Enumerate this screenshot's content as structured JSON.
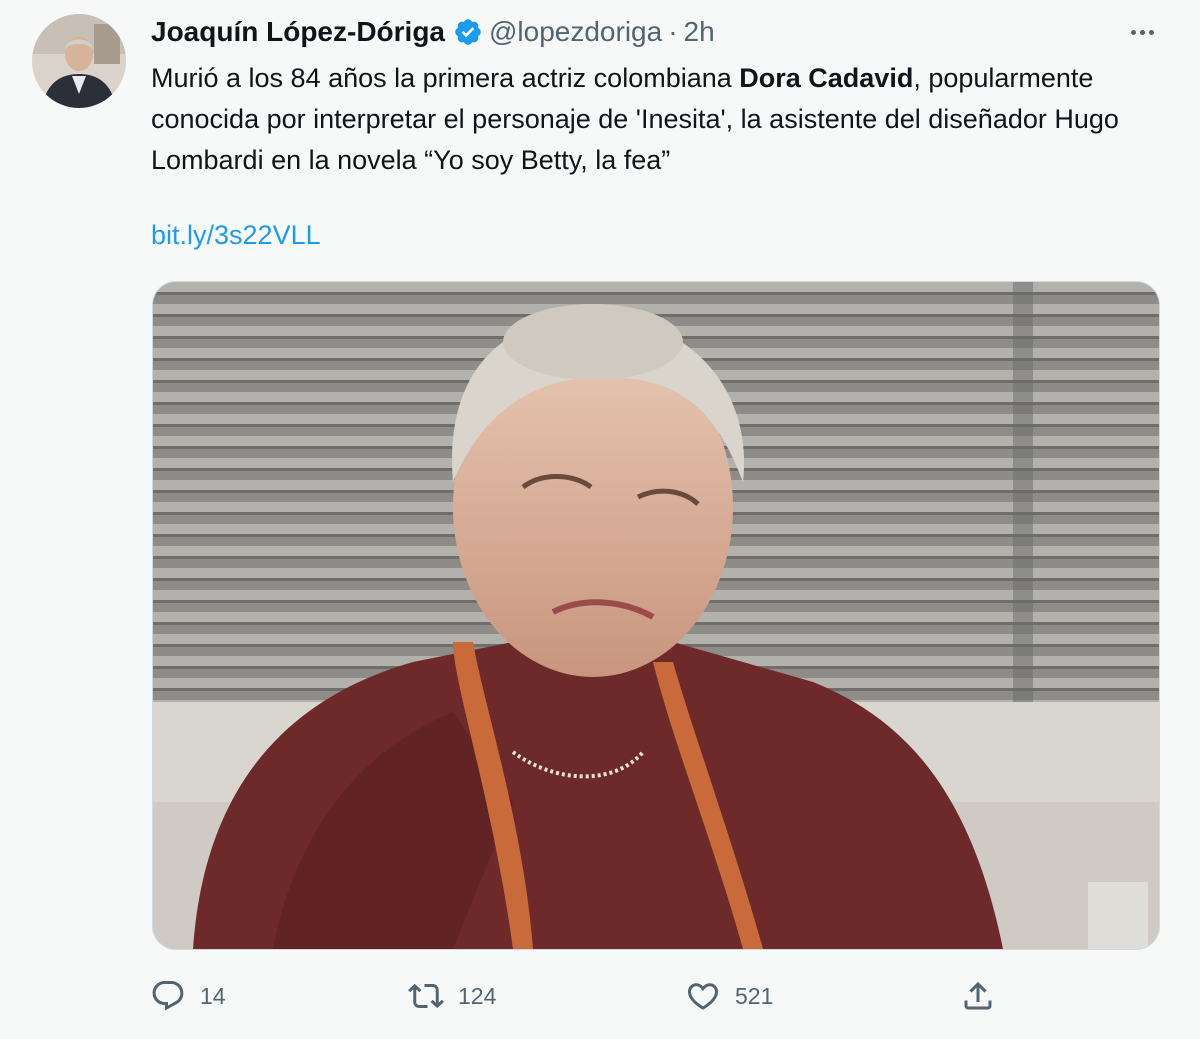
{
  "author": {
    "display_name": "Joaquín López-Dóriga",
    "handle": "@lopezdoriga",
    "separator": "·",
    "time": "2h",
    "verified": true
  },
  "tweet": {
    "text_part1": "Murió a los 84 años la primera actriz colombiana ",
    "text_bold": "Dora Cadavid",
    "text_part2": ", popularmente conocida por interpretar el personaje de 'Inesita', la asistente del diseñador Hugo Lombardi en la novela “Yo soy Betty, la fea”",
    "link": "bit.ly/3s22VLL"
  },
  "actions": {
    "replies": "14",
    "retweets": "124",
    "likes": "521"
  },
  "icons": [
    "verified-badge-icon",
    "more-options-icon",
    "reply-icon",
    "retweet-icon",
    "like-icon",
    "share-icon"
  ],
  "colors": {
    "accent": "#1d9bf0",
    "secondary_text": "#536471",
    "background": "#f7f9f9"
  }
}
